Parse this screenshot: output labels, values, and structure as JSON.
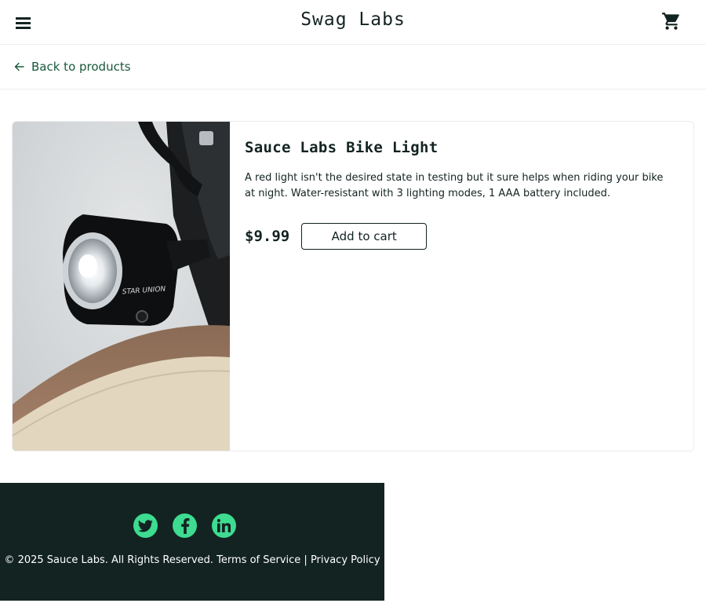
{
  "header": {
    "logo": "Swag Labs",
    "menu_icon": "hamburger-menu-icon",
    "cart_icon": "shopping-cart-icon"
  },
  "nav": {
    "back_label": "Back to products",
    "back_icon": "arrow-left-icon"
  },
  "product": {
    "name": "Sauce Labs Bike Light",
    "description": "A red light isn't the desired state in testing but it sure helps when riding your bike at night. Water-resistant with 3 lighting modes, 1 AAA battery included.",
    "price": "$9.99",
    "add_label": "Add to cart",
    "image_label": "STAR UNION"
  },
  "footer": {
    "copyright": "© 2025 Sauce Labs. All Rights Reserved. Terms of Service | Privacy Policy",
    "social": [
      "twitter-icon",
      "facebook-icon",
      "linkedin-icon"
    ]
  },
  "colors": {
    "brand_dark": "#132322",
    "accent_green": "#3ddc91",
    "link_green": "#18583a"
  }
}
